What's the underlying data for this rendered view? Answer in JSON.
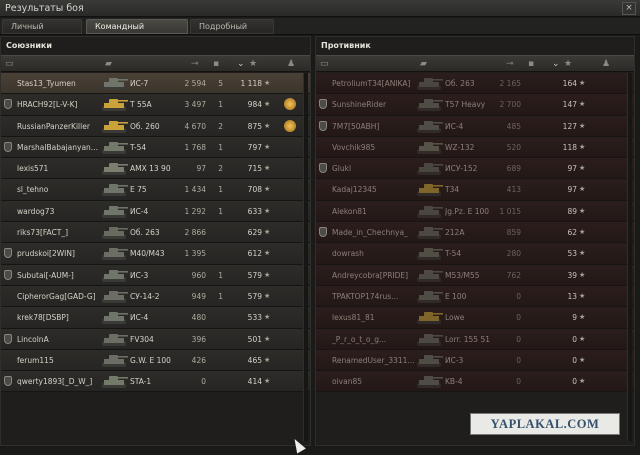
{
  "window": {
    "title": "Результаты боя",
    "close_glyph": "×"
  },
  "tabs": [
    {
      "label": "Личный результат",
      "active": false
    },
    {
      "label": "Командный результат",
      "active": true
    },
    {
      "label": "Подробный отчёт",
      "active": false
    }
  ],
  "allies": {
    "title": "Союзники",
    "rows": [
      {
        "name": "Stas13_Tyumen",
        "vehicle": "ИС-7",
        "damage": "2 594",
        "kills": "5",
        "xp": "1 118",
        "highlight": true,
        "squad": false,
        "medal": false,
        "tank": "heavy"
      },
      {
        "name": "HRACH92[L-V-K]",
        "vehicle": "T 55A",
        "damage": "3 497",
        "kills": "1",
        "xp": "984",
        "highlight": false,
        "squad": true,
        "medal": true,
        "tank": "premium"
      },
      {
        "name": "RussianPanzerKiller",
        "vehicle": "Об. 260",
        "damage": "4 670",
        "kills": "2",
        "xp": "875",
        "highlight": false,
        "squad": false,
        "medal": true,
        "tank": "premium"
      },
      {
        "name": "MarshalBabajanyan...",
        "vehicle": "T-54",
        "damage": "1 768",
        "kills": "1",
        "xp": "797",
        "highlight": false,
        "squad": true,
        "medal": false,
        "tank": "medium"
      },
      {
        "name": "lexis571",
        "vehicle": "AMX 13 90",
        "damage": "97",
        "kills": "2",
        "xp": "715",
        "highlight": false,
        "squad": false,
        "medal": false,
        "tank": "light"
      },
      {
        "name": "sl_tehno",
        "vehicle": "E 75",
        "damage": "1 434",
        "kills": "1",
        "xp": "708",
        "highlight": false,
        "squad": false,
        "medal": false,
        "tank": "heavy"
      },
      {
        "name": "wardog73",
        "vehicle": "ИС-4",
        "damage": "1 292",
        "kills": "1",
        "xp": "633",
        "highlight": false,
        "squad": false,
        "medal": false,
        "tank": "heavy"
      },
      {
        "name": "riks73[FACT_]",
        "vehicle": "Об. 263",
        "damage": "2 866",
        "kills": "",
        "xp": "629",
        "highlight": false,
        "squad": false,
        "medal": false,
        "tank": "td"
      },
      {
        "name": "prudskoi[2WIN]",
        "vehicle": "M40/M43",
        "damage": "1 395",
        "kills": "",
        "xp": "612",
        "highlight": false,
        "squad": true,
        "medal": false,
        "tank": "spg"
      },
      {
        "name": "Subutai[-AUM-]",
        "vehicle": "ИС-3",
        "damage": "960",
        "kills": "1",
        "xp": "579",
        "highlight": false,
        "squad": true,
        "medal": false,
        "tank": "heavy"
      },
      {
        "name": "CipherorGag[GAD-G]",
        "vehicle": "СУ-14-2",
        "damage": "949",
        "kills": "1",
        "xp": "579",
        "highlight": false,
        "squad": false,
        "medal": false,
        "tank": "spg"
      },
      {
        "name": "krek78[DSBP]",
        "vehicle": "ИС-4",
        "damage": "480",
        "kills": "",
        "xp": "533",
        "highlight": false,
        "squad": false,
        "medal": false,
        "tank": "heavy"
      },
      {
        "name": "LincolnA",
        "vehicle": "FV304",
        "damage": "396",
        "kills": "",
        "xp": "501",
        "highlight": false,
        "squad": true,
        "medal": false,
        "tank": "spg"
      },
      {
        "name": "ferum115",
        "vehicle": "G.W. E 100",
        "damage": "426",
        "kills": "",
        "xp": "465",
        "highlight": false,
        "squad": false,
        "medal": false,
        "tank": "spg"
      },
      {
        "name": "qwerty1893[_D_W_]",
        "vehicle": "STA-1",
        "damage": "0",
        "kills": "",
        "xp": "414",
        "highlight": false,
        "squad": true,
        "medal": false,
        "tank": "medium"
      }
    ]
  },
  "enemies": {
    "title": "Противник",
    "rows": [
      {
        "name": "PetroliumT34[ANIKA]",
        "vehicle": "Об. 263",
        "damage": "2 165",
        "kills": "",
        "xp": "164",
        "squad": false,
        "tank": "td"
      },
      {
        "name": "SunshineRider",
        "vehicle": "T57 Heavy",
        "damage": "2 700",
        "kills": "",
        "xp": "147",
        "squad": true,
        "tank": "heavy"
      },
      {
        "name": "7M7[50ABH]",
        "vehicle": "ИС-4",
        "damage": "485",
        "kills": "",
        "xp": "127",
        "squad": true,
        "tank": "heavy"
      },
      {
        "name": "Vovchik985",
        "vehicle": "WZ-132",
        "damage": "520",
        "kills": "",
        "xp": "118",
        "squad": false,
        "tank": "light"
      },
      {
        "name": "Glukl",
        "vehicle": "ИСУ-152",
        "damage": "689",
        "kills": "",
        "xp": "97",
        "squad": true,
        "tank": "td"
      },
      {
        "name": "Kadaj12345",
        "vehicle": "T34",
        "damage": "413",
        "kills": "",
        "xp": "97",
        "squad": false,
        "tank": "premium"
      },
      {
        "name": "Alekon81",
        "vehicle": "Jg.Pz. E 100",
        "damage": "1 015",
        "kills": "",
        "xp": "89",
        "squad": false,
        "tank": "td"
      },
      {
        "name": "Made_in_Chechnya_",
        "vehicle": "212A",
        "damage": "859",
        "kills": "",
        "xp": "62",
        "squad": true,
        "tank": "spg"
      },
      {
        "name": "dowrash",
        "vehicle": "T-54",
        "damage": "280",
        "kills": "",
        "xp": "53",
        "squad": false,
        "tank": "medium"
      },
      {
        "name": "Andreycobra[PRIDE]",
        "vehicle": "M53/M55",
        "damage": "762",
        "kills": "",
        "xp": "39",
        "squad": false,
        "tank": "spg"
      },
      {
        "name": "TPAKTOP174rus...",
        "vehicle": "E 100",
        "damage": "0",
        "kills": "",
        "xp": "13",
        "squad": false,
        "tank": "heavy"
      },
      {
        "name": "lexus81_81",
        "vehicle": "Lowe",
        "damage": "0",
        "kills": "",
        "xp": "9",
        "squad": false,
        "tank": "premium"
      },
      {
        "name": "_P_r_o_t_o_g...",
        "vehicle": "Lorr. 155 51",
        "damage": "0",
        "kills": "",
        "xp": "0",
        "squad": false,
        "tank": "spg"
      },
      {
        "name": "RenamedUser_3311...",
        "vehicle": "ИС-3",
        "damage": "0",
        "kills": "",
        "xp": "0",
        "squad": false,
        "tank": "heavy"
      },
      {
        "name": "oivan85",
        "vehicle": "KB-4",
        "damage": "0",
        "kills": "",
        "xp": "0",
        "squad": false,
        "tank": "heavy"
      }
    ]
  },
  "watermark": "YAPLAKAL.COM",
  "colors": {
    "ally_highlight": "#4a4136",
    "enemy_row": "#2b1e1c",
    "medal": "#f2c45a",
    "premium_tank": "#c9a23a"
  }
}
